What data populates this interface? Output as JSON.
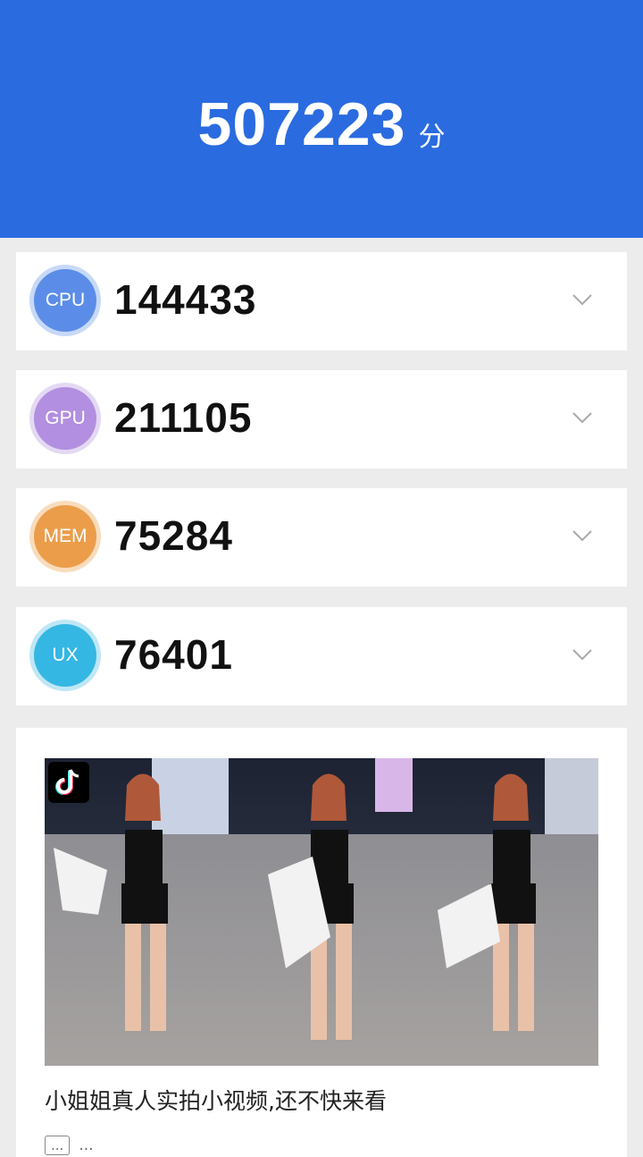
{
  "total": {
    "score": "507223",
    "unit": "分"
  },
  "scores": [
    {
      "label": "CPU",
      "value": "144433",
      "color": "#5b8de8"
    },
    {
      "label": "GPU",
      "value": "211105",
      "color": "#b28fe0"
    },
    {
      "label": "MEM",
      "value": "75284",
      "color": "#ec9d4a"
    },
    {
      "label": "UX",
      "value": "76401",
      "color": "#35b7e3"
    }
  ],
  "ad": {
    "title": "小姐姐真人实拍小视频,还不快来看",
    "tag": "...",
    "source": "...",
    "image_icon": "tiktok-logo-icon"
  },
  "colors": {
    "header": "#2a6be0",
    "background": "#ececec",
    "card": "#ffffff"
  }
}
